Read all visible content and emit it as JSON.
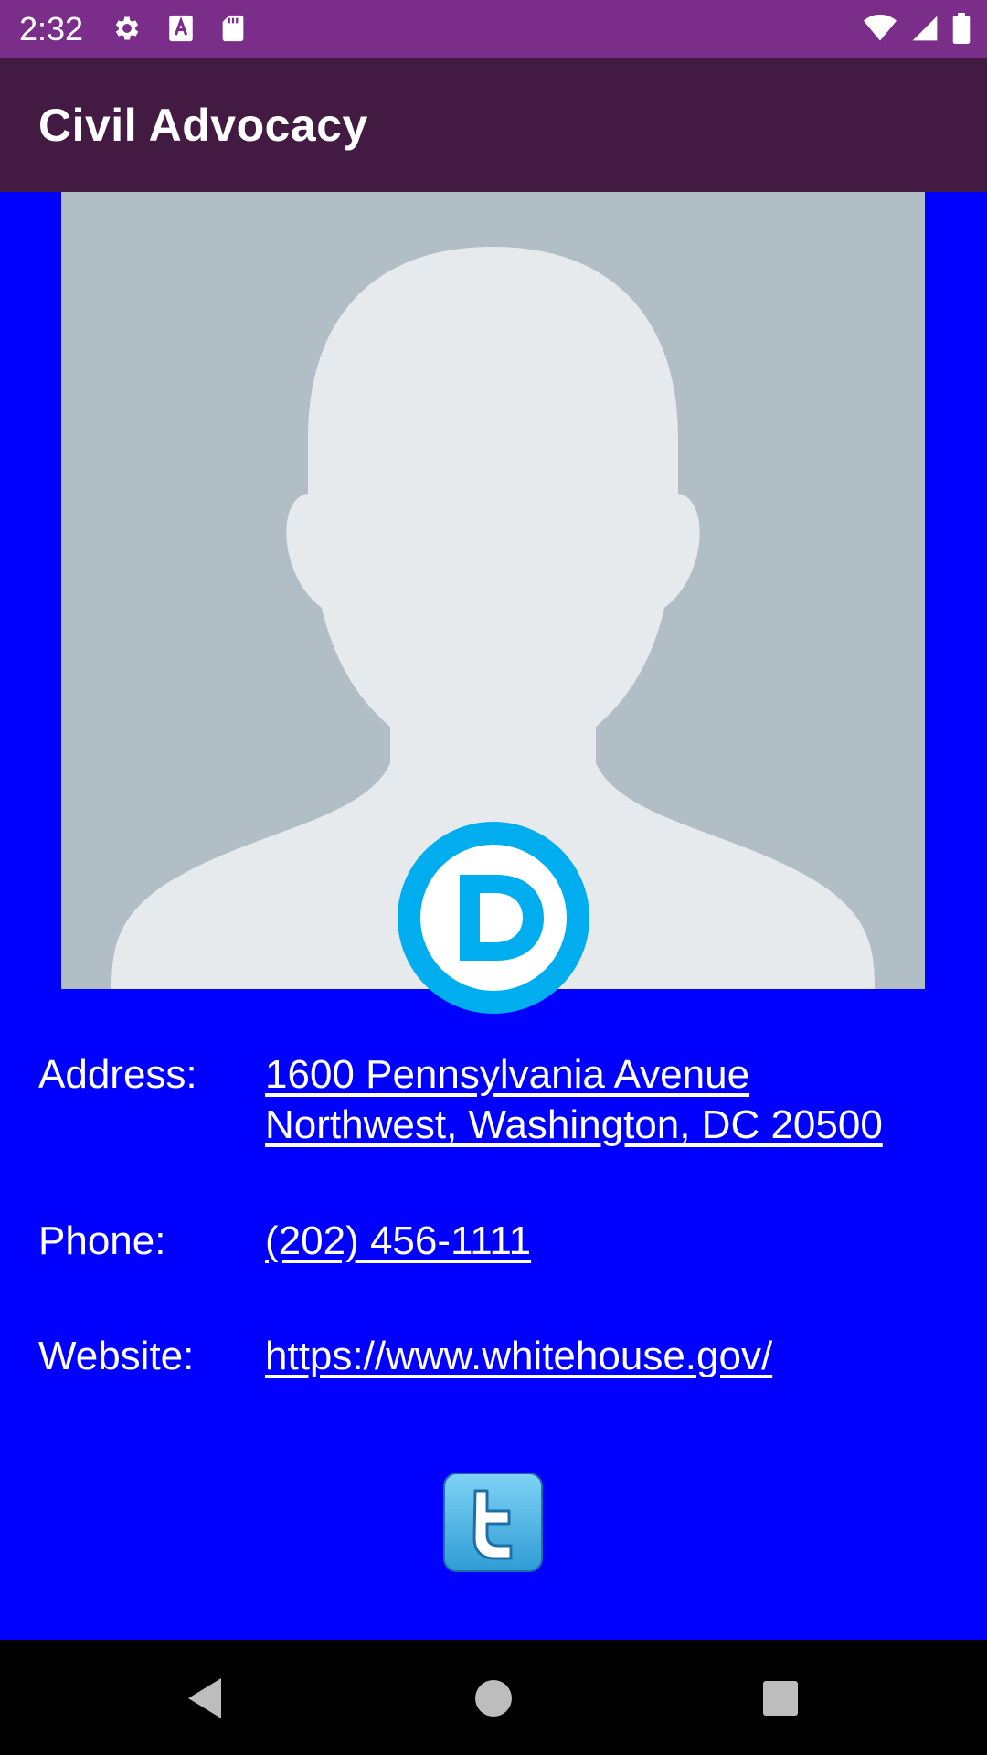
{
  "status_bar": {
    "time": "2:32",
    "icons": [
      "gear-icon",
      "text-a-icon",
      "sd-card-icon",
      "wifi-icon",
      "signal-icon",
      "battery-icon"
    ]
  },
  "app_bar": {
    "title": "Civil Advocacy"
  },
  "official": {
    "photo": "avatar-placeholder",
    "party_logo": "democratic-d-icon"
  },
  "details": {
    "address_label": "Address:",
    "address_line1": "1600 Pennsylvania Avenue",
    "address_line2": "Northwest, Washington, DC 20500",
    "phone_label": "Phone:",
    "phone_value": "(202) 456-1111",
    "website_label": "Website:",
    "website_value": "https://www.whitehouse.gov/"
  },
  "social": {
    "twitter_icon": "twitter-icon"
  },
  "nav_bar": {
    "back": "back-triangle-icon",
    "home": "home-circle-icon",
    "recents": "recents-square-icon"
  },
  "colors": {
    "status_bar": "#7B2D8A",
    "app_bar": "#421A42",
    "background": "#0000FF",
    "photo_bg": "#B1BEC6",
    "silhouette": "#E6EAED",
    "party_blue": "#00AEEF"
  }
}
